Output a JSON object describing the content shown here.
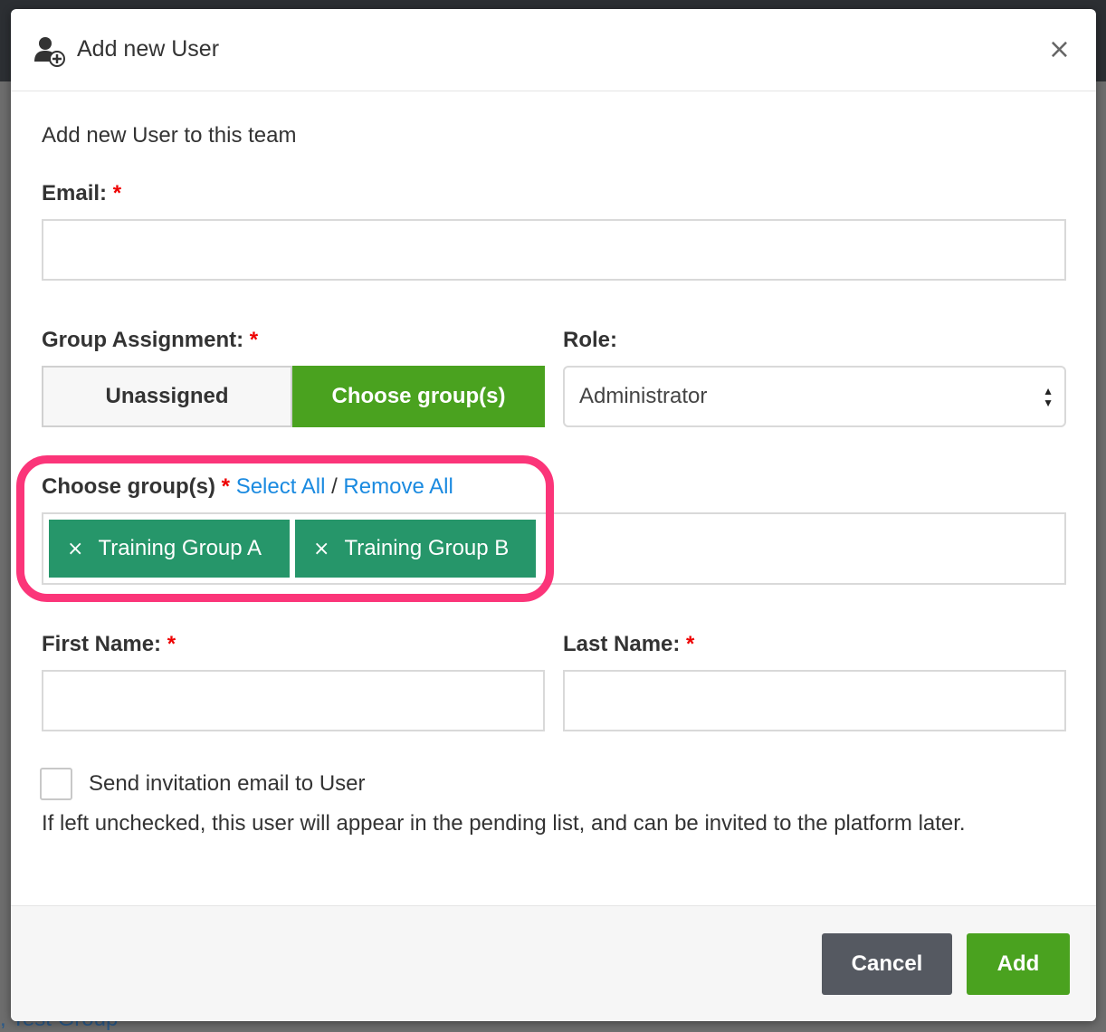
{
  "modal": {
    "title": "Add new User",
    "close_label": "×",
    "subtitle": "Add new User to this team"
  },
  "form": {
    "email_label": "Email:",
    "required_mark": "*",
    "email_value": "",
    "group_assignment_label": "Group Assignment:",
    "unassigned_label": "Unassigned",
    "choose_groups_label": "Choose group(s)",
    "role_label": "Role:",
    "role_value": "Administrator",
    "choose_groups_field_label": "Choose group(s)",
    "select_all_label": "Select All",
    "separator": "/",
    "remove_all_label": "Remove All",
    "selected_groups": [
      {
        "label": "Training Group A",
        "remove": "×"
      },
      {
        "label": "Training Group B",
        "remove": "×"
      }
    ],
    "first_name_label": "First Name:",
    "first_name_value": "",
    "last_name_label": "Last Name:",
    "last_name_value": "",
    "invite_label": "Send invitation email to User",
    "invite_checked": false,
    "invite_help": "If left unchecked, this user will appear in the pending list, and can be invited to the platform later."
  },
  "footer": {
    "cancel_label": "Cancel",
    "add_label": "Add"
  },
  "background": {
    "bottom_link_text": "Test Group"
  },
  "colors": {
    "primary_green": "#4aa21f",
    "tag_green": "#26966a",
    "link_blue": "#1a8ae0",
    "required_red": "#e00000",
    "highlight_pink": "#fb3579",
    "cancel_gray": "#555961"
  },
  "icons": {
    "header": "add-user-icon",
    "close": "close-icon",
    "select_arrows": "sort-arrows-icon",
    "tag_remove": "remove-tag-icon"
  }
}
